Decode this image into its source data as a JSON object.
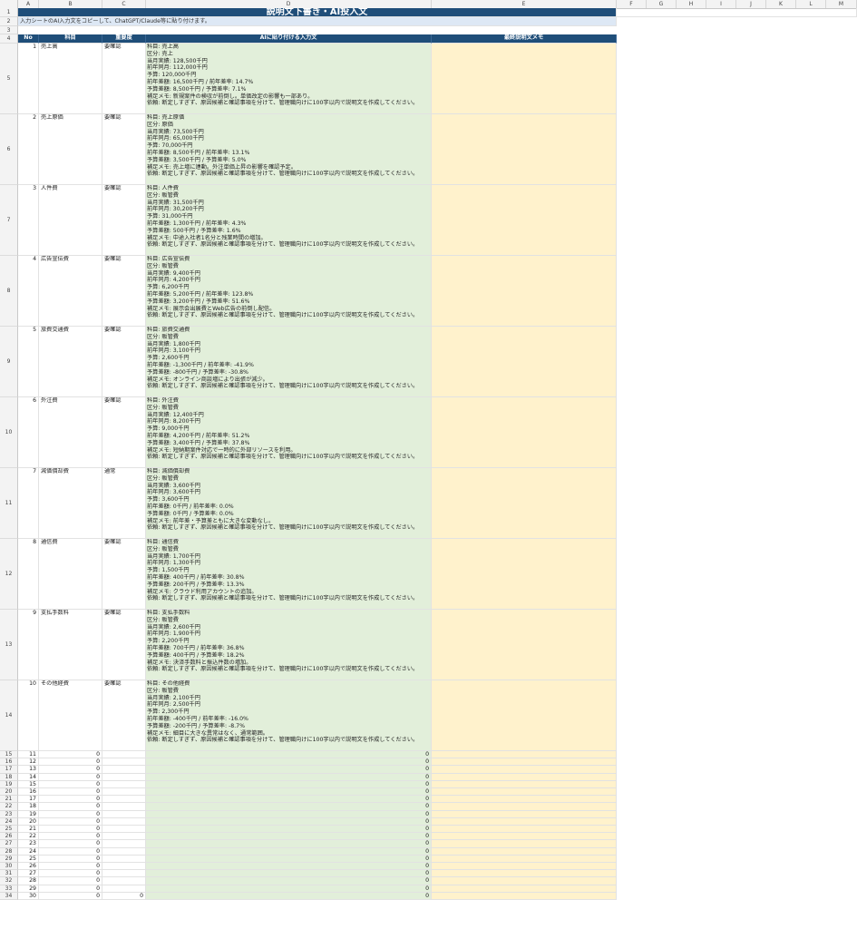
{
  "sheet": {
    "columns": [
      "A",
      "B",
      "C",
      "D",
      "E",
      "F",
      "G",
      "H",
      "I",
      "J",
      "K",
      "L",
      "M"
    ],
    "title": "説明文下書き・AI投入文",
    "note": "入力シートのAI入力文をコピーして、ChatGPT/Claude等に貼り付けます。",
    "headers": {
      "no": "No",
      "item": "科目",
      "importance": "重要度",
      "ai_input": "AIに貼り付ける入力文",
      "memo": "最終説明文メモ"
    },
    "rows": [
      {
        "row": "5",
        "no": "1",
        "item": "売上高",
        "importance": "要確認",
        "text": "科目: 売上高\n区分: 売上\n当月実績: 128,500千円\n前年同月: 112,000千円\n予算: 120,000千円\n前年差額: 16,500千円 / 前年差率: 14.7%\n予算差額: 8,500千円 / 予算差率: 7.1%\n補足メモ: 新規案件の検収が前倒し。単価改定の影響も一部あり。\n依頼: 断定しすぎず、原因候補と確認事項を分けて、管理職向けに100字以内で説明文を作成してください。"
      },
      {
        "row": "6",
        "no": "2",
        "item": "売上原価",
        "importance": "要確認",
        "text": "科目: 売上原価\n区分: 原価\n当月実績: 73,500千円\n前年同月: 65,000千円\n予算: 70,000千円\n前年差額: 8,500千円 / 前年差率: 13.1%\n予算差額: 3,500千円 / 予算差率: 5.0%\n補足メモ: 売上増に連動。外注単価上昇の影響を確認予定。\n依頼: 断定しすぎず、原因候補と確認事項を分けて、管理職向けに100字以内で説明文を作成してください。"
      },
      {
        "row": "7",
        "no": "3",
        "item": "人件費",
        "importance": "要確認",
        "text": "科目: 人件費\n区分: 販管費\n当月実績: 31,500千円\n前年同月: 30,200千円\n予算: 31,000千円\n前年差額: 1,300千円 / 前年差率: 4.3%\n予算差額: 500千円 / 予算差率: 1.6%\n補足メモ: 中途入社者1名分と残業時間の増加。\n依頼: 断定しすぎず、原因候補と確認事項を分けて、管理職向けに100字以内で説明文を作成してください。"
      },
      {
        "row": "8",
        "no": "4",
        "item": "広告宣伝費",
        "importance": "要確認",
        "text": "科目: 広告宣伝費\n区分: 販管費\n当月実績: 9,400千円\n前年同月: 4,200千円\n予算: 6,200千円\n前年差額: 5,200千円 / 前年差率: 123.8%\n予算差額: 3,200千円 / 予算差率: 51.6%\n補足メモ: 展示会出展費とWeb広告の前倒し配信。\n依頼: 断定しすぎず、原因候補と確認事項を分けて、管理職向けに100字以内で説明文を作成してください。"
      },
      {
        "row": "9",
        "no": "5",
        "item": "旅費交通費",
        "importance": "要確認",
        "text": "科目: 旅費交通費\n区分: 販管費\n当月実績: 1,800千円\n前年同月: 3,100千円\n予算: 2,600千円\n前年差額: -1,300千円 / 前年差率: -41.9%\n予算差額: -800千円 / 予算差率: -30.8%\n補足メモ: オンライン商談増により出張が減少。\n依頼: 断定しすぎず、原因候補と確認事項を分けて、管理職向けに100字以内で説明文を作成してください。"
      },
      {
        "row": "10",
        "no": "6",
        "item": "外注費",
        "importance": "要確認",
        "text": "科目: 外注費\n区分: 販管費\n当月実績: 12,400千円\n前年同月: 8,200千円\n予算: 9,000千円\n前年差額: 4,200千円 / 前年差率: 51.2%\n予算差額: 3,400千円 / 予算差率: 37.8%\n補足メモ: 短納期案件対応で一時的に外部リソースを利用。\n依頼: 断定しすぎず、原因候補と確認事項を分けて、管理職向けに100字以内で説明文を作成してください。"
      },
      {
        "row": "11",
        "no": "7",
        "item": "減価償却費",
        "importance": "通常",
        "text": "科目: 減価償却費\n区分: 販管費\n当月実績: 3,600千円\n前年同月: 3,600千円\n予算: 3,600千円\n前年差額: 0千円 / 前年差率: 0.0%\n予算差額: 0千円 / 予算差率: 0.0%\n補足メモ: 前年差・予算差ともに大きな変動なし。\n依頼: 断定しすぎず、原因候補と確認事項を分けて、管理職向けに100字以内で説明文を作成してください。"
      },
      {
        "row": "12",
        "no": "8",
        "item": "通信費",
        "importance": "要確認",
        "text": "科目: 通信費\n区分: 販管費\n当月実績: 1,700千円\n前年同月: 1,300千円\n予算: 1,500千円\n前年差額: 400千円 / 前年差率: 30.8%\n予算差額: 200千円 / 予算差率: 13.3%\n補足メモ: クラウド利用アカウントの追加。\n依頼: 断定しすぎず、原因候補と確認事項を分けて、管理職向けに100字以内で説明文を作成してください。"
      },
      {
        "row": "13",
        "no": "9",
        "item": "支払手数料",
        "importance": "要確認",
        "text": "科目: 支払手数料\n区分: 販管費\n当月実績: 2,600千円\n前年同月: 1,900千円\n予算: 2,200千円\n前年差額: 700千円 / 前年差率: 36.8%\n予算差額: 400千円 / 予算差率: 18.2%\n補足メモ: 決済手数料と振込件数の増加。\n依頼: 断定しすぎず、原因候補と確認事項を分けて、管理職向けに100字以内で説明文を作成してください。"
      },
      {
        "row": "14",
        "no": "10",
        "item": "その他経費",
        "importance": "要確認",
        "text": "科目: その他経費\n区分: 販管費\n当月実績: 2,100千円\n前年同月: 2,500千円\n予算: 2,300千円\n前年差額: -400千円 / 前年差率: -16.0%\n予算差額: -200千円 / 予算差率: -8.7%\n補足メモ: 細目に大きな異常はなく、通常範囲。\n依頼: 断定しすぎず、原因候補と確認事項を分けて、管理職向けに100字以内で説明文を作成してください。"
      }
    ],
    "empty_rows": [
      {
        "row": "15",
        "no": "11",
        "b": "0",
        "d": "0"
      },
      {
        "row": "16",
        "no": "12",
        "b": "0",
        "d": "0"
      },
      {
        "row": "17",
        "no": "13",
        "b": "0",
        "d": "0"
      },
      {
        "row": "18",
        "no": "14",
        "b": "0",
        "d": "0"
      },
      {
        "row": "19",
        "no": "15",
        "b": "0",
        "d": "0"
      },
      {
        "row": "20",
        "no": "16",
        "b": "0",
        "d": "0"
      },
      {
        "row": "21",
        "no": "17",
        "b": "0",
        "d": "0"
      },
      {
        "row": "22",
        "no": "18",
        "b": "0",
        "d": "0"
      },
      {
        "row": "23",
        "no": "19",
        "b": "0",
        "d": "0"
      },
      {
        "row": "24",
        "no": "20",
        "b": "0",
        "d": "0"
      },
      {
        "row": "25",
        "no": "21",
        "b": "0",
        "d": "0"
      },
      {
        "row": "26",
        "no": "22",
        "b": "0",
        "d": "0"
      },
      {
        "row": "27",
        "no": "23",
        "b": "0",
        "d": "0"
      },
      {
        "row": "28",
        "no": "24",
        "b": "0",
        "d": "0"
      },
      {
        "row": "29",
        "no": "25",
        "b": "0",
        "d": "0"
      },
      {
        "row": "30",
        "no": "26",
        "b": "0",
        "d": "0"
      },
      {
        "row": "31",
        "no": "27",
        "b": "0",
        "d": "0"
      },
      {
        "row": "32",
        "no": "28",
        "b": "0",
        "d": "0"
      },
      {
        "row": "33",
        "no": "29",
        "b": "0",
        "d": "0"
      },
      {
        "row": "34",
        "no": "30",
        "b": "0",
        "c": "0",
        "d": "0"
      }
    ],
    "row_labels_top": [
      "1",
      "2",
      "3",
      "4"
    ]
  }
}
